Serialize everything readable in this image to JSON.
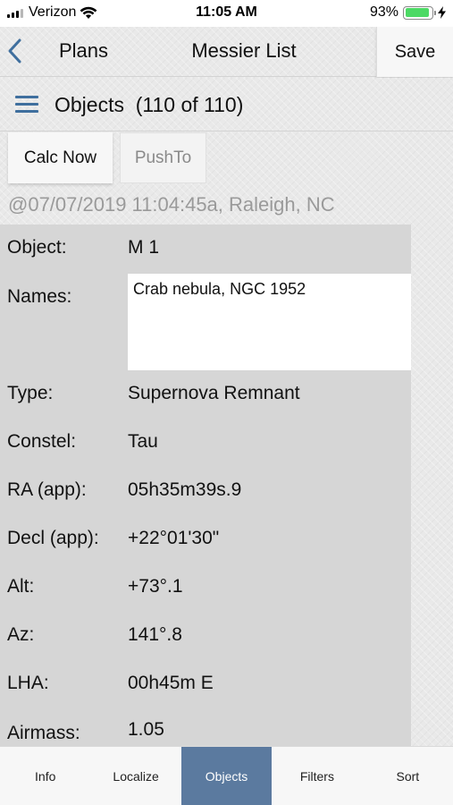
{
  "status_bar": {
    "carrier": "Verizon",
    "time": "11:05 AM",
    "battery_percent": "93%",
    "battery_level": 0.93,
    "colors": {
      "battery_fill": "#4cd964"
    },
    "icons": [
      "signal-icon",
      "wifi-icon",
      "battery-icon",
      "charging-bolt-icon"
    ]
  },
  "nav": {
    "back_label": "Plans",
    "title": "Messier List",
    "save_label": "Save",
    "icons": [
      "chevron-left-icon"
    ],
    "colors": {
      "back_chevron": "#3f6f9e"
    }
  },
  "list_header": {
    "title": "Objects  (110 of 110)",
    "icons": [
      "menu-icon"
    ],
    "colors": {
      "menu_icon": "#3f6f9e"
    }
  },
  "actions": {
    "calc_now_label": "Calc Now",
    "pushto_label": "PushTo"
  },
  "timestamp": "@07/07/2019 11:04:45a, Raleigh, NC",
  "details": {
    "object": {
      "label": "Object:",
      "value": "M 1"
    },
    "names": {
      "label": "Names:",
      "value": "Crab nebula, NGC 1952"
    },
    "type": {
      "label": "Type:",
      "value": "Supernova Remnant"
    },
    "constel": {
      "label": "Constel:",
      "value": "Tau"
    },
    "ra": {
      "label": "RA (app):",
      "value": "05h35m39s.9"
    },
    "decl": {
      "label": "Decl (app):",
      "value": "+22°01'30\""
    },
    "alt": {
      "label": "Alt:",
      "value": "+73°.1"
    },
    "az": {
      "label": "Az:",
      "value": "141°.8"
    },
    "lha": {
      "label": "LHA:",
      "value": "00h45m E"
    },
    "airmass": {
      "label": "Airmass:",
      "value": "1.05"
    }
  },
  "tabs": [
    {
      "label": "Info",
      "active": false
    },
    {
      "label": "Localize",
      "active": false
    },
    {
      "label": "Objects",
      "active": true
    },
    {
      "label": "Filters",
      "active": false
    },
    {
      "label": "Sort",
      "active": false
    }
  ],
  "colors": {
    "active_tab": "#5b7a9f",
    "details_background": "#d6d6d6"
  }
}
